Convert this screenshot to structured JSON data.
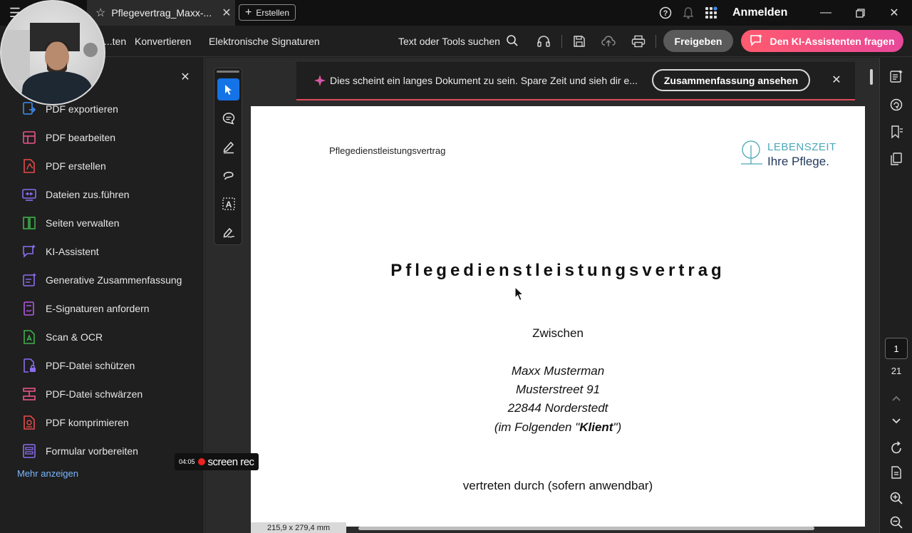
{
  "titlebar": {
    "tab_title": "Pflegevertrag_Maxx-...",
    "new_button_label": "Erstellen",
    "signin_label": "Anmelden"
  },
  "menubar": {
    "items": [
      "...ten",
      "Konvertieren",
      "Elektronische Signaturen"
    ],
    "search_label": "Text oder Tools suchen",
    "share_label": "Freigeben",
    "ai_label": "Den KI-Assistenten fragen"
  },
  "tools": {
    "items": [
      {
        "label": "PDF exportieren",
        "icon": "export-pdf-icon",
        "color": "#3b8df0"
      },
      {
        "label": "PDF bearbeiten",
        "icon": "edit-pdf-icon",
        "color": "#e8548a"
      },
      {
        "label": "PDF erstellen",
        "icon": "create-pdf-icon",
        "color": "#e84a4a"
      },
      {
        "label": "Dateien zus.führen",
        "icon": "combine-files-icon",
        "color": "#8a6df0"
      },
      {
        "label": "Seiten verwalten",
        "icon": "organize-pages-icon",
        "color": "#3fb04a"
      },
      {
        "label": "KI-Assistent",
        "icon": "ai-assistant-icon",
        "color": "#8a6df0"
      },
      {
        "label": "Generative Zusammenfassung",
        "icon": "generative-summary-icon",
        "color": "#8a6df0"
      },
      {
        "label": "E-Signaturen anfordern",
        "icon": "request-esign-icon",
        "color": "#b45ae0"
      },
      {
        "label": "Scan & OCR",
        "icon": "scan-ocr-icon",
        "color": "#3fb04a"
      },
      {
        "label": "PDF-Datei schützen",
        "icon": "protect-pdf-icon",
        "color": "#8a6df0"
      },
      {
        "label": "PDF-Datei schwärzen",
        "icon": "redact-pdf-icon",
        "color": "#e8548a"
      },
      {
        "label": "PDF komprimieren",
        "icon": "compress-pdf-icon",
        "color": "#e84a4a"
      },
      {
        "label": "Formular vorbereiten",
        "icon": "prepare-form-icon",
        "color": "#8a6df0"
      }
    ],
    "more_label": "Mehr anzeigen"
  },
  "screenrec": {
    "time": "04:05",
    "brand": "screen rec"
  },
  "banner": {
    "text": "Dies scheint ein langes Dokument zu sein. Spare Zeit und sieh dir e...",
    "button_label": "Zusammenfassung ansehen"
  },
  "document": {
    "header_text": "Pflegedienstleistungsvertrag",
    "logo_line1": "LEBENSZEIT",
    "logo_line2": "Ihre Pflege.",
    "title": "Pflegedienstleistungsvertrag",
    "between": "Zwischen",
    "name": "Maxx Musterman",
    "street": "Musterstreet 91",
    "city": "22844 Norderstedt",
    "role_prefix": "(im Folgenden \"",
    "role_bold": "Klient",
    "role_suffix": "\")",
    "represented": "vertreten durch (sofern anwendbar)"
  },
  "statusbar": {
    "page_size": "215,9 x 279,4 mm"
  },
  "pagenav": {
    "current": "1",
    "total": "21"
  },
  "colors": {
    "accent": "#1473e6",
    "ai_gradient_start": "#ff5a6e",
    "ai_gradient_end": "#e8489a",
    "link": "#7ab7ff"
  }
}
